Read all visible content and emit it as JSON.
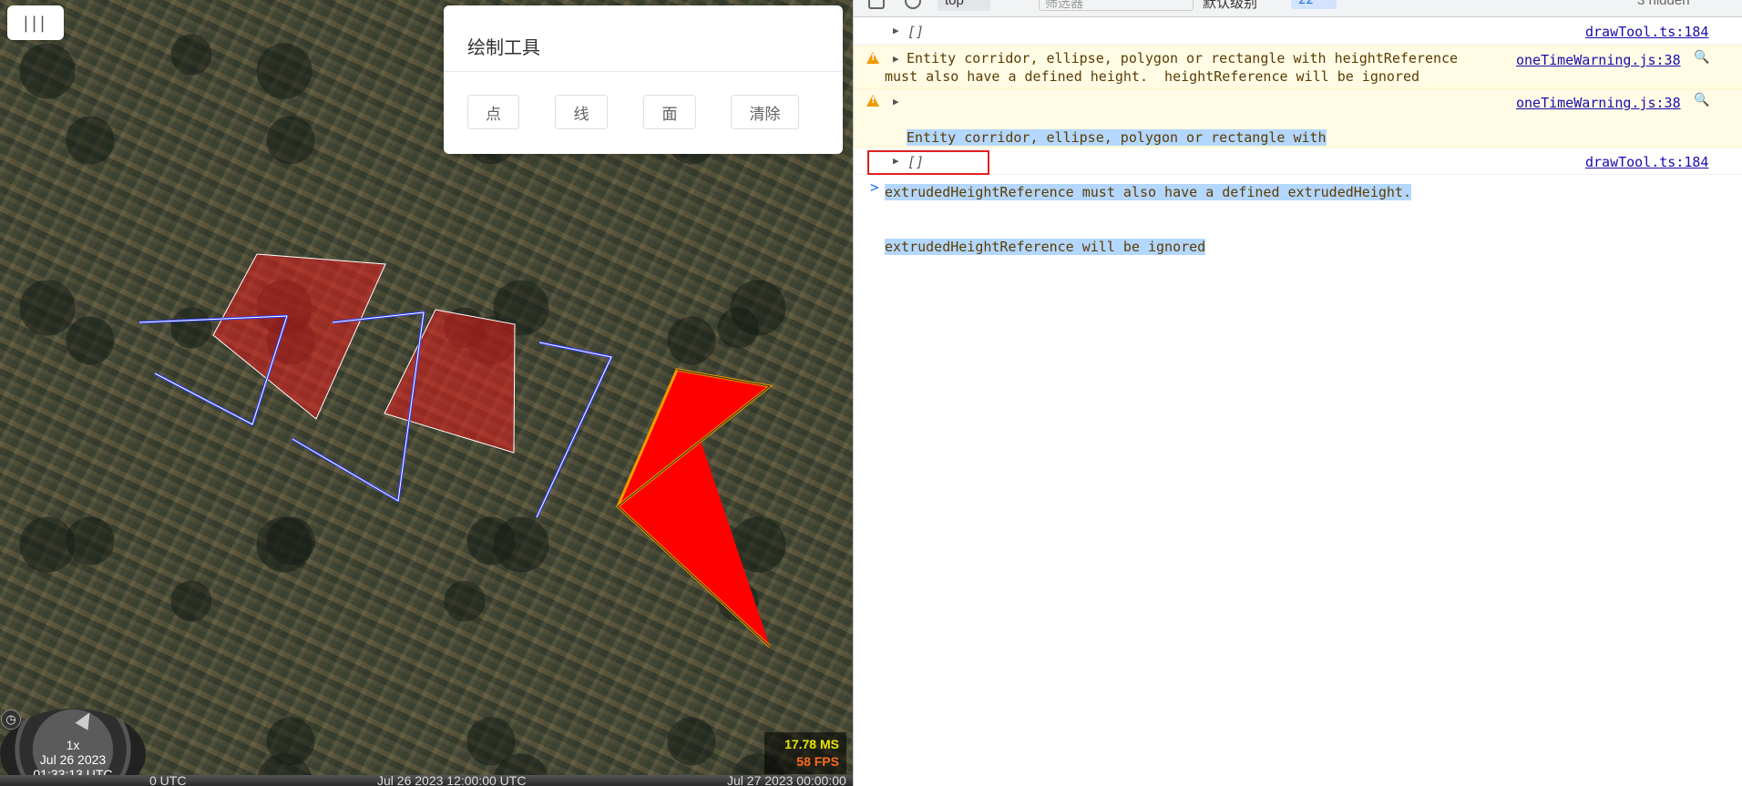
{
  "map": {
    "menu_icon": "|||",
    "draw_panel": {
      "title": "绘制工具",
      "buttons": [
        "点",
        "线",
        "面",
        "清除"
      ]
    },
    "perf": {
      "ms": "17.78 MS",
      "fps": "58 FPS"
    },
    "animation": {
      "speed": "1x",
      "date": "Jul 26 2023",
      "time": "01:33:13 UTC"
    },
    "timeline": [
      "0 UTC",
      "Jul 26 2023 12:00:00 UTC",
      "Jul 27 2023 00:00:00"
    ],
    "colors": {
      "polygon_fill": "#ff0000",
      "line_white_blue": "#3344ff",
      "line_orange": "#f29900"
    }
  },
  "console": {
    "toolbar": {
      "context": "top",
      "filter_placeholder": "筛选器",
      "levels": "默认级别",
      "issues": "22",
      "hidden": "3 hidden"
    },
    "rows": [
      {
        "type": "log",
        "content": "[]",
        "source": "drawTool.ts:184"
      },
      {
        "type": "warning",
        "content": "Entity corridor, ellipse, polygon or rectangle with heightReference must also have a defined height.  heightReference will be ignored",
        "source": "oneTimeWarning.js:38"
      },
      {
        "type": "warning",
        "content_line1": "Entity corridor, ellipse, polygon or rectangle with",
        "content_line2": "extrudedHeightReference must also have a defined extrudedHeight.",
        "content_line3": "extrudedHeightReference will be ignored",
        "source": "oneTimeWarning.js:38"
      },
      {
        "type": "log",
        "content": "[]",
        "source": "drawTool.ts:184"
      }
    ],
    "prompt": ">"
  }
}
